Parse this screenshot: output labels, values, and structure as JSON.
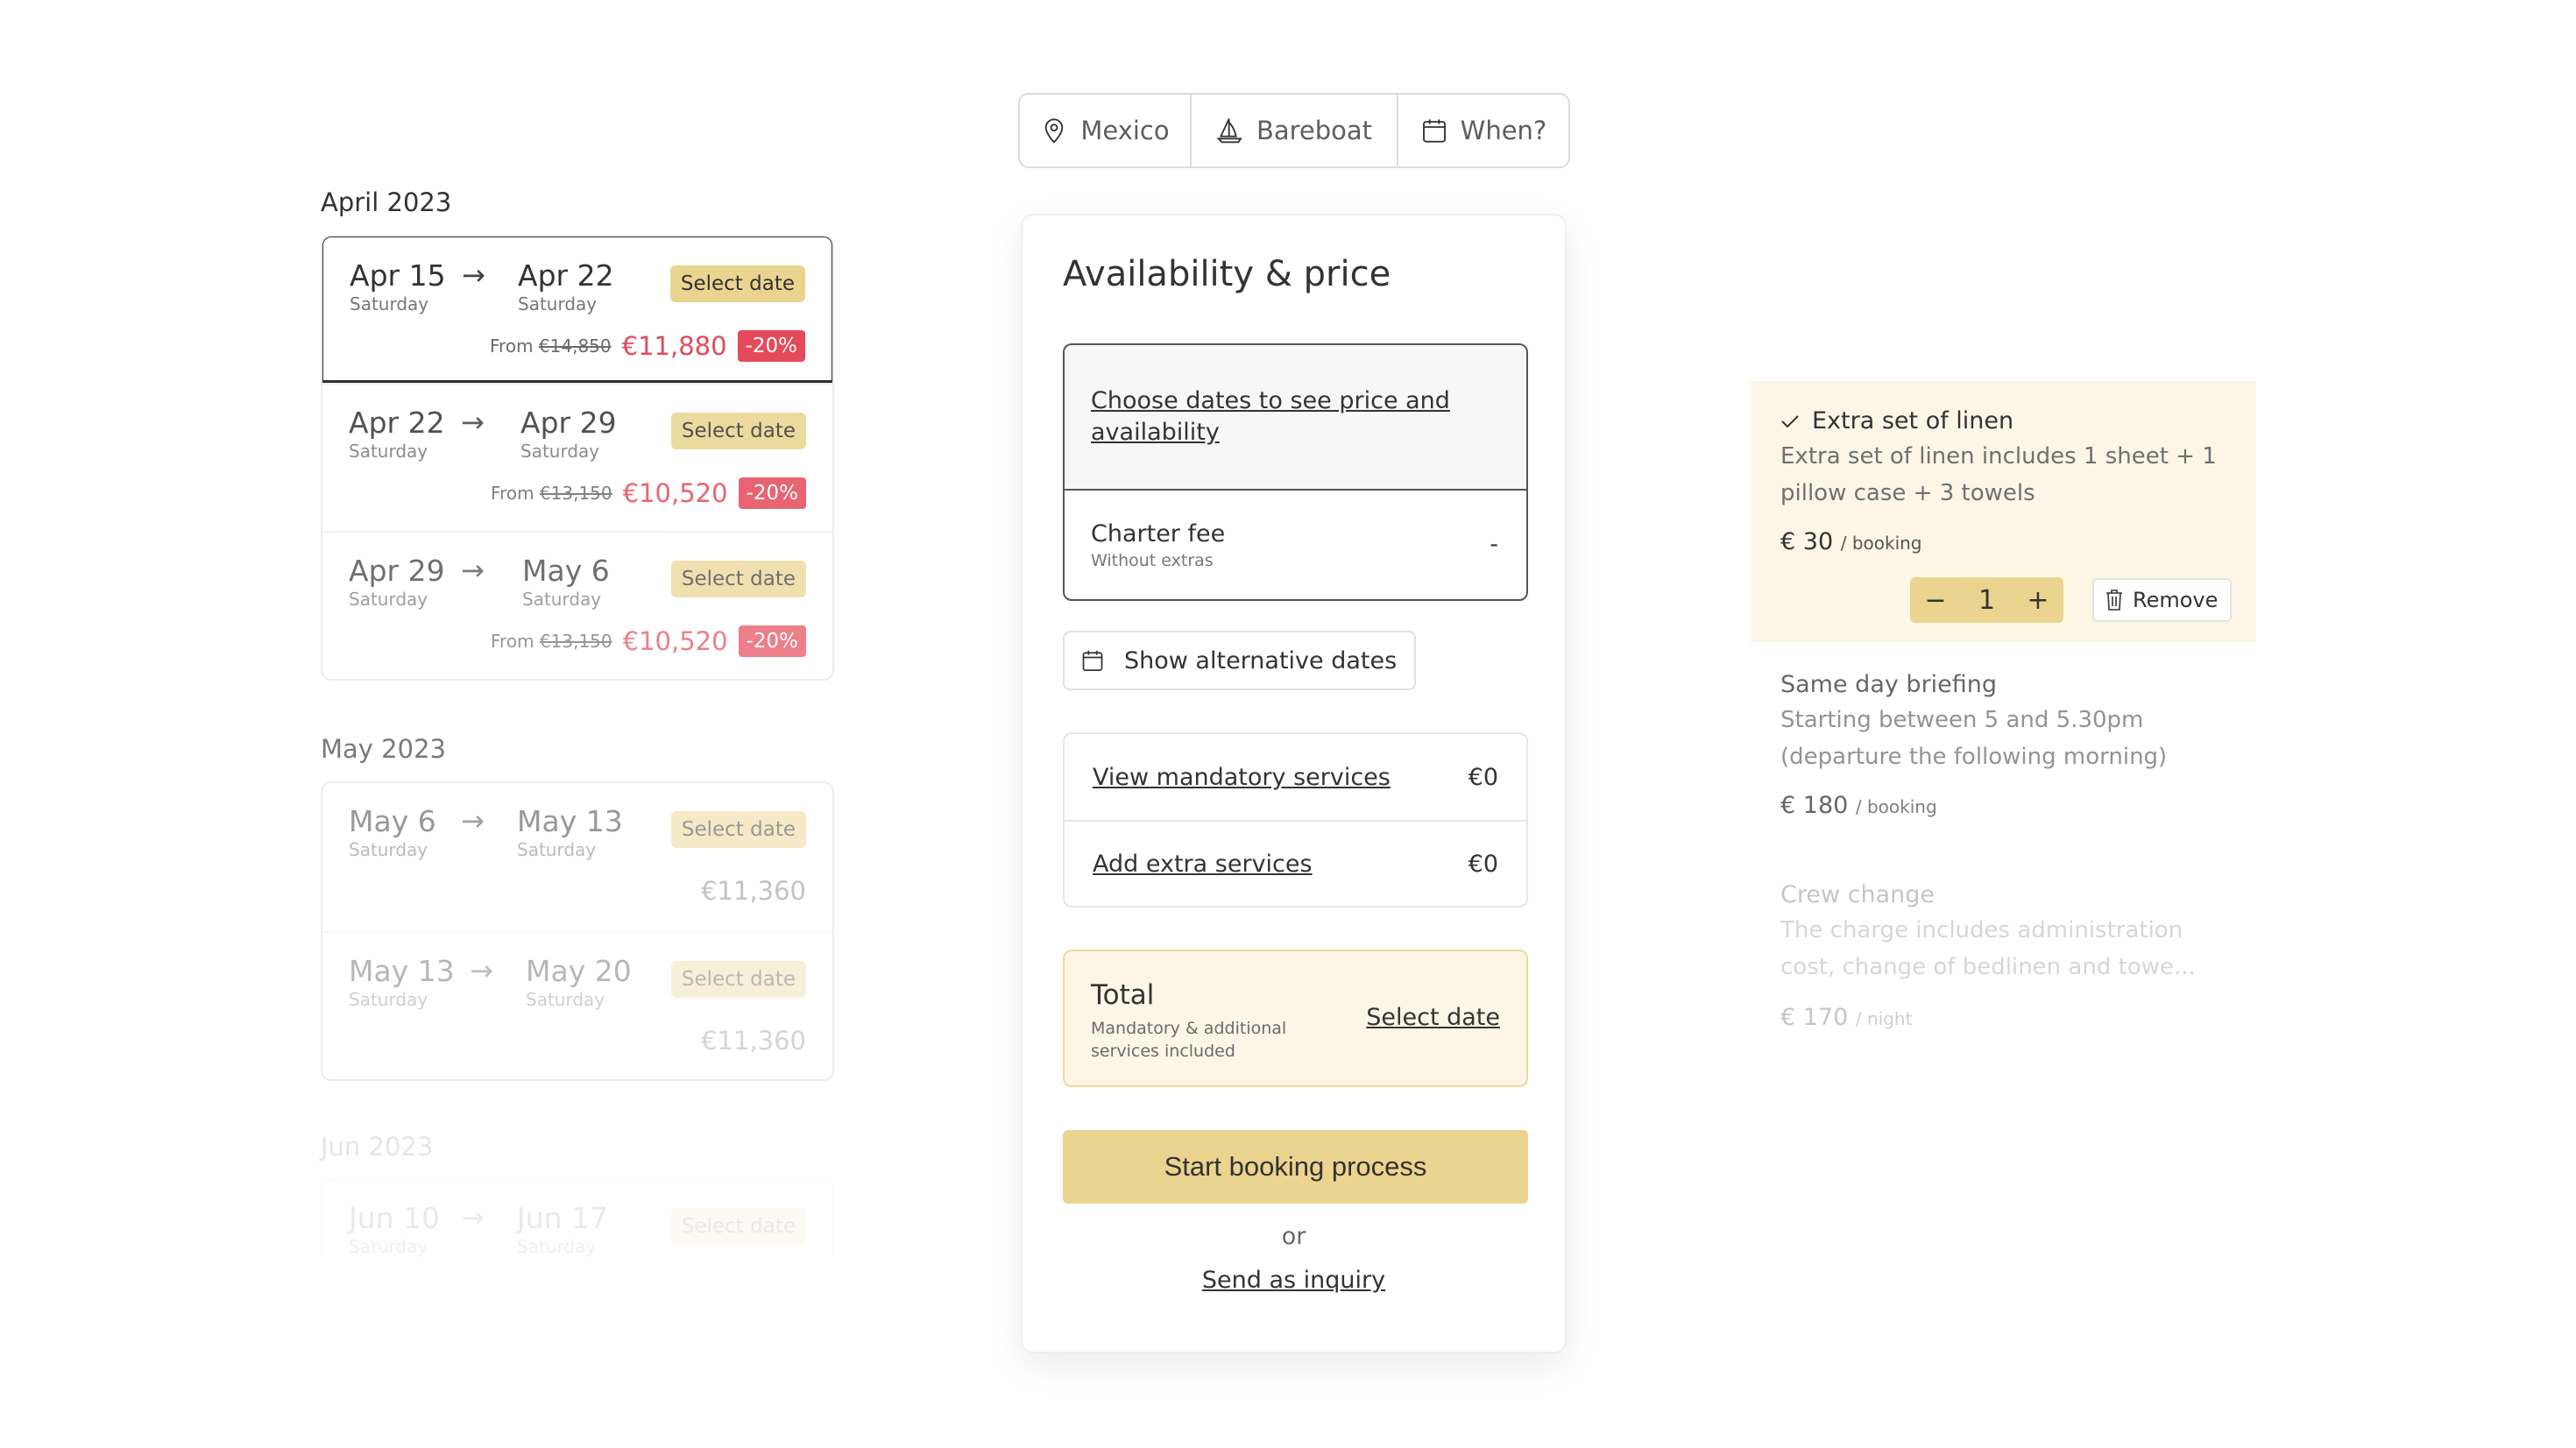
{
  "search_bar": {
    "location": {
      "label": "Mexico",
      "icon": "map-pin-icon"
    },
    "boat_type": {
      "label": "Bareboat",
      "icon": "sailboat-icon"
    },
    "dates": {
      "label": "When?",
      "icon": "calendar-icon"
    }
  },
  "date_list": {
    "months": [
      {
        "label": "April 2023",
        "options": [
          {
            "from_day": "Apr 15",
            "from_weekday": "Saturday",
            "to_day": "Apr 22",
            "to_weekday": "Saturday",
            "select_label": "Select date",
            "from_prefix": "From",
            "original_price": "€14,850",
            "price": "€11,880",
            "discount": "-20%",
            "selected": true
          },
          {
            "from_day": "Apr 22",
            "from_weekday": "Saturday",
            "to_day": "Apr 29",
            "to_weekday": "Saturday",
            "select_label": "Select date",
            "from_prefix": "From",
            "original_price": "€13,150",
            "price": "€10,520",
            "discount": "-20%",
            "selected": false
          },
          {
            "from_day": "Apr 29",
            "from_weekday": "Saturday",
            "to_day": "May 6",
            "to_weekday": "Saturday",
            "select_label": "Select date",
            "from_prefix": "From",
            "original_price": "€13,150",
            "price": "€10,520",
            "discount": "-20%",
            "selected": false
          }
        ]
      },
      {
        "label": "May 2023",
        "options": [
          {
            "from_day": "May 6",
            "from_weekday": "Saturday",
            "to_day": "May 13",
            "to_weekday": "Saturday",
            "select_label": "Select date",
            "price": "€11,360"
          },
          {
            "from_day": "May 13",
            "from_weekday": "Saturday",
            "to_day": "May 20",
            "to_weekday": "Saturday",
            "select_label": "Select date",
            "price": "€11,360"
          }
        ]
      },
      {
        "label": "Jun 2023",
        "options": [
          {
            "from_day": "Jun 10",
            "from_weekday": "Saturday",
            "to_day": "Jun 17",
            "to_weekday": "Saturday",
            "select_label": "Select date"
          }
        ]
      }
    ],
    "arrow_icon": "→"
  },
  "booking_panel": {
    "title": "Availability & price",
    "choose_dates_link": "Choose dates to see price and availability",
    "charter_fee": {
      "label": "Charter fee",
      "sublabel": "Without extras",
      "value": "-"
    },
    "alt_dates_button": "Show alternative dates",
    "services": [
      {
        "label": "View mandatory services",
        "value": "€0"
      },
      {
        "label": "Add extra services",
        "value": "€0"
      }
    ],
    "total": {
      "label": "Total",
      "sublabel": "Mandatory & additional services included",
      "action": "Select date"
    },
    "start_button": "Start booking process",
    "or_text": "or",
    "inquiry_link": "Send as inquiry"
  },
  "extras": [
    {
      "title": "Extra set of linen",
      "checked": true,
      "description": "Extra set of linen includes 1 sheet + 1 pillow case + 3 towels",
      "price": "€ 30",
      "unit": "/ booking",
      "quantity": "1",
      "decrement": "−",
      "increment": "+",
      "remove_label": "Remove"
    },
    {
      "title": "Same day briefing",
      "checked": false,
      "description": "Starting between 5 and 5.30pm (departure the following morning)",
      "price": "€ 180",
      "unit": "/ booking"
    },
    {
      "title": "Crew change",
      "checked": false,
      "description": "The charge includes administration cost, change of bedlinen and towe...",
      "price": "€ 170",
      "unit": "/ night"
    }
  ],
  "colors": {
    "accent_gold": "#ebd48f",
    "highlight_cream": "#fdf6e6",
    "discount_red": "#e54a5a",
    "text_dark": "#333333"
  }
}
